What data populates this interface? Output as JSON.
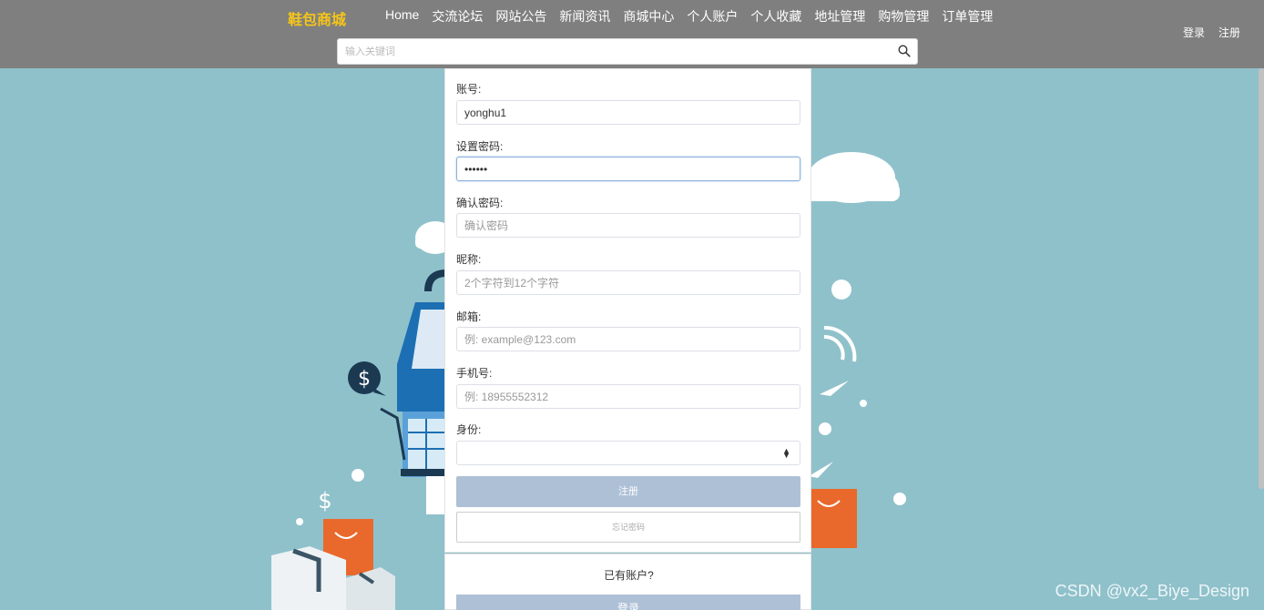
{
  "header": {
    "brand": "鞋包商城",
    "nav": [
      "Home",
      "交流论坛",
      "网站公告",
      "新闻资讯",
      "商城中心",
      "个人账户",
      "个人收藏",
      "地址管理",
      "购物管理",
      "订单管理"
    ],
    "login": "登录",
    "register": "注册",
    "search_placeholder": "输入关键词",
    "search_icon": "search-icon"
  },
  "form": {
    "account_label": "账号:",
    "account_value": "yonghu1",
    "password_label": "设置密码:",
    "password_value": "••••••",
    "confirm_label": "确认密码:",
    "confirm_placeholder": "确认密码",
    "nickname_label": "昵称:",
    "nickname_placeholder": "2个字符到12个字符",
    "email_label": "邮箱:",
    "email_placeholder": "例: example@123.com",
    "phone_label": "手机号:",
    "phone_placeholder": "例: 18955552312",
    "role_label": "身份:",
    "role_value": "",
    "register_button": "注册",
    "forgot_button": "忘记密码"
  },
  "login_section": {
    "have_account": "已有账户?",
    "login_button": "登录"
  },
  "watermark": "CSDN @vx2_Biye_Design",
  "colors": {
    "topbar": "#7f7f7f",
    "background": "#8fc1cb",
    "brand": "#f5c518",
    "button": "#adc0d6",
    "accent_orange": "#e8692b",
    "accent_blue": "#1d6fb3"
  }
}
